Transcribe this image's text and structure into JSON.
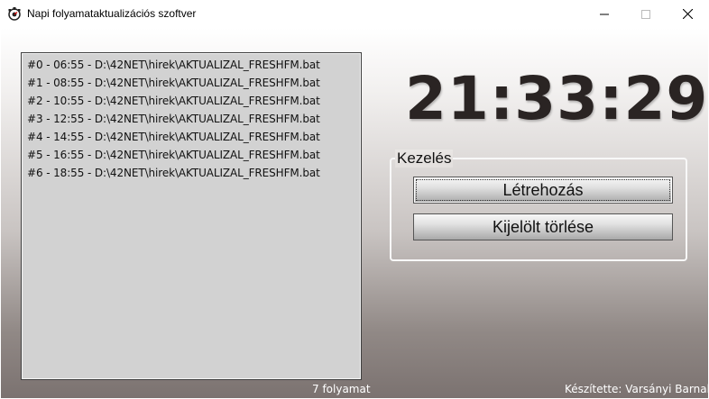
{
  "window": {
    "title": "Napi folyamataktualizációs szoftver",
    "app_icon": "clock-gear-icon",
    "controls": [
      "minimize-icon",
      "maximize-icon",
      "close-icon"
    ]
  },
  "processes": {
    "items": [
      "#0 - 06:55 - D:\\42NET\\hirek\\AKTUALIZAL_FRESHFM.bat",
      "#1 - 08:55 - D:\\42NET\\hirek\\AKTUALIZAL_FRESHFM.bat",
      "#2 - 10:55 - D:\\42NET\\hirek\\AKTUALIZAL_FRESHFM.bat",
      "#3 - 12:55 - D:\\42NET\\hirek\\AKTUALIZAL_FRESHFM.bat",
      "#4 - 14:55 - D:\\42NET\\hirek\\AKTUALIZAL_FRESHFM.bat",
      "#5 - 16:55 - D:\\42NET\\hirek\\AKTUALIZAL_FRESHFM.bat",
      "#6 - 18:55 - D:\\42NET\\hirek\\AKTUALIZAL_FRESHFM.bat"
    ],
    "count_label": "7 folyamat"
  },
  "clock": {
    "time": "21:33:29"
  },
  "management": {
    "legend": "Kezelés",
    "create_label": "Létrehozás",
    "delete_label": "Kijelölt törlése"
  },
  "footer": {
    "author": "Készítette: Varsányi Barnabás"
  },
  "colors": {
    "clock_text": "#2a2423",
    "list_background": "#d2d2d2"
  }
}
